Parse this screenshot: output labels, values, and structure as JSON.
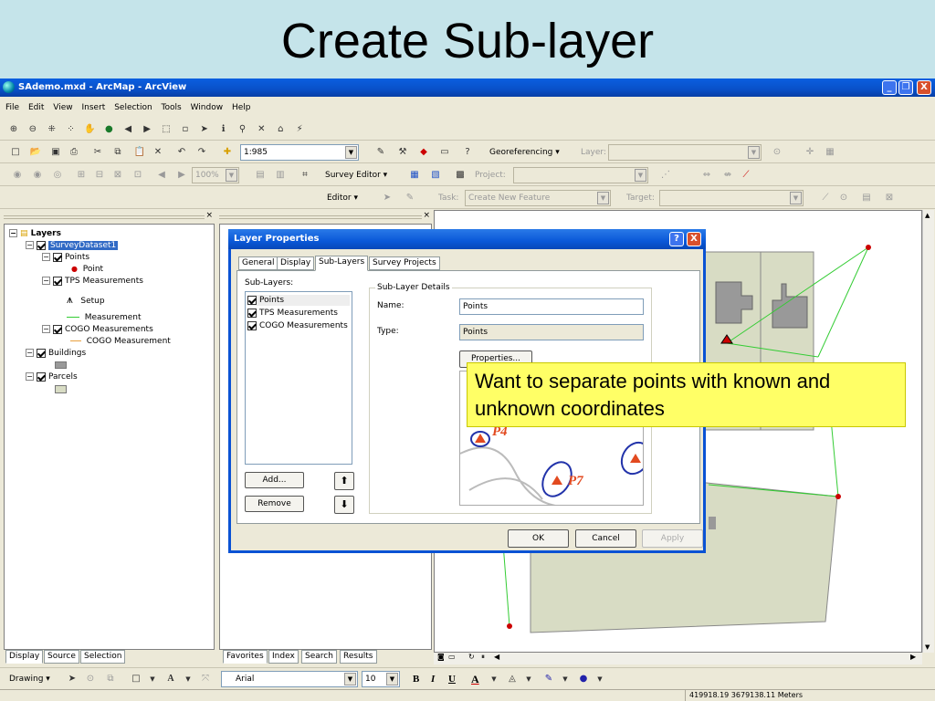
{
  "slide": {
    "title": "Create Sub-layer"
  },
  "window": {
    "title": "SAdemo.mxd - ArcMap - ArcView",
    "min": "_",
    "max": "❐",
    "close": "X"
  },
  "menu": [
    "File",
    "Edit",
    "View",
    "Insert",
    "Selection",
    "Tools",
    "Window",
    "Help"
  ],
  "standard": {
    "scale": "1:985",
    "georef": "Georeferencing ▾",
    "layer_label": "Layer:"
  },
  "survey": {
    "zoom": "100%",
    "editor": "Survey Editor ▾",
    "project_label": "Project:"
  },
  "editor": {
    "label": "Editor ▾",
    "task_label": "Task:",
    "task_value": "Create New Feature",
    "target_label": "Target:"
  },
  "toc": {
    "root": "Layers",
    "dataset": "SurveyDataset1",
    "points": "Points",
    "point": "Point",
    "tps": "TPS Measurements",
    "setup": "Setup",
    "measurement": "Measurement",
    "cogo": "COGO Measurements",
    "cogo_m": "COGO Measurement",
    "buildings": "Buildings",
    "parcels": "Parcels",
    "tabs": [
      "Display",
      "Source",
      "Selection"
    ]
  },
  "catalog": {
    "tabs": [
      "Favorites",
      "Index",
      "Search",
      "Results"
    ]
  },
  "dialog": {
    "title": "Layer Properties",
    "help": "?",
    "close": "X",
    "tabs": [
      "General",
      "Display",
      "Sub-Layers",
      "Survey Projects"
    ],
    "sublayers_label": "Sub-Layers:",
    "sublayers": [
      "Points",
      "TPS Measurements",
      "COGO Measurements"
    ],
    "details_label": "Sub-Layer Details",
    "name_label": "Name:",
    "name_value": "Points",
    "type_label": "Type:",
    "type_value": "Points",
    "properties_btn": "Properties...",
    "add_btn": "Add...",
    "remove_btn": "Remove",
    "up": "⬆",
    "down": "⬇",
    "ok": "OK",
    "cancel": "Cancel",
    "apply": "Apply",
    "preview_labels": [
      "P4",
      "P7"
    ]
  },
  "callout": "Want to separate points with known and unknown coordinates",
  "drawing": {
    "label": "Drawing ▾",
    "font": "Arial",
    "size": "10",
    "bold": "B",
    "italic": "I",
    "underline": "U",
    "fontcolor": "A"
  },
  "status": {
    "coords": "419918.19  3679138.11 Meters"
  },
  "colors": {
    "xp_blue": "#0a5fe0",
    "selection": "#316ac5",
    "callout": "#ffff66",
    "vertex": "#cc0000",
    "line": "#33cc33",
    "parcel": "#d8dcc4"
  }
}
